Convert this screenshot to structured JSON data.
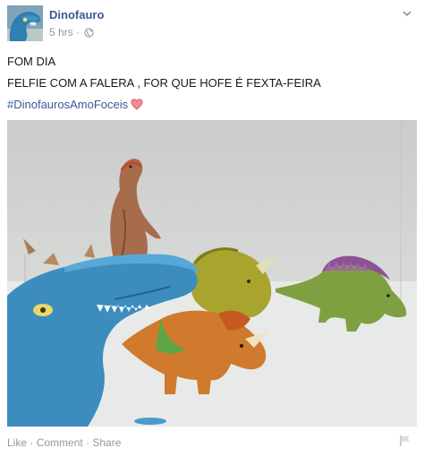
{
  "post": {
    "author": "Dinofauro",
    "timestamp": "5 hrs",
    "meta_separator": " · ",
    "privacy_icon": "globe-icon",
    "text_lines": [
      "FOM DIA",
      "FELFIE COM A FALERA , FOR QUE HOFE É FEXTA-FEIRA"
    ],
    "hashtag": "#DinofaurosAmoFoceis",
    "hashtag_emoji": "heart-icon",
    "menu_icon": "chevron-down-icon"
  },
  "photo": {
    "subject": "toy dinosaurs photo",
    "colors": {
      "background": "#d4d6d5",
      "floor": "#e9ebea",
      "blue_dino": "#3f8fbf",
      "brown_dino": "#a0674a",
      "yellow_dino": "#a9a630",
      "orange_dino": "#cf7a2c",
      "purple_dino": "#8a5a93"
    }
  },
  "actions": {
    "like": "Like",
    "comment": "Comment",
    "share": "Share",
    "separator": " · ",
    "flag_icon": "flag-icon"
  },
  "theme": {
    "link_color": "#3b5998",
    "meta_color": "#9197a3",
    "text_color": "#141823"
  }
}
